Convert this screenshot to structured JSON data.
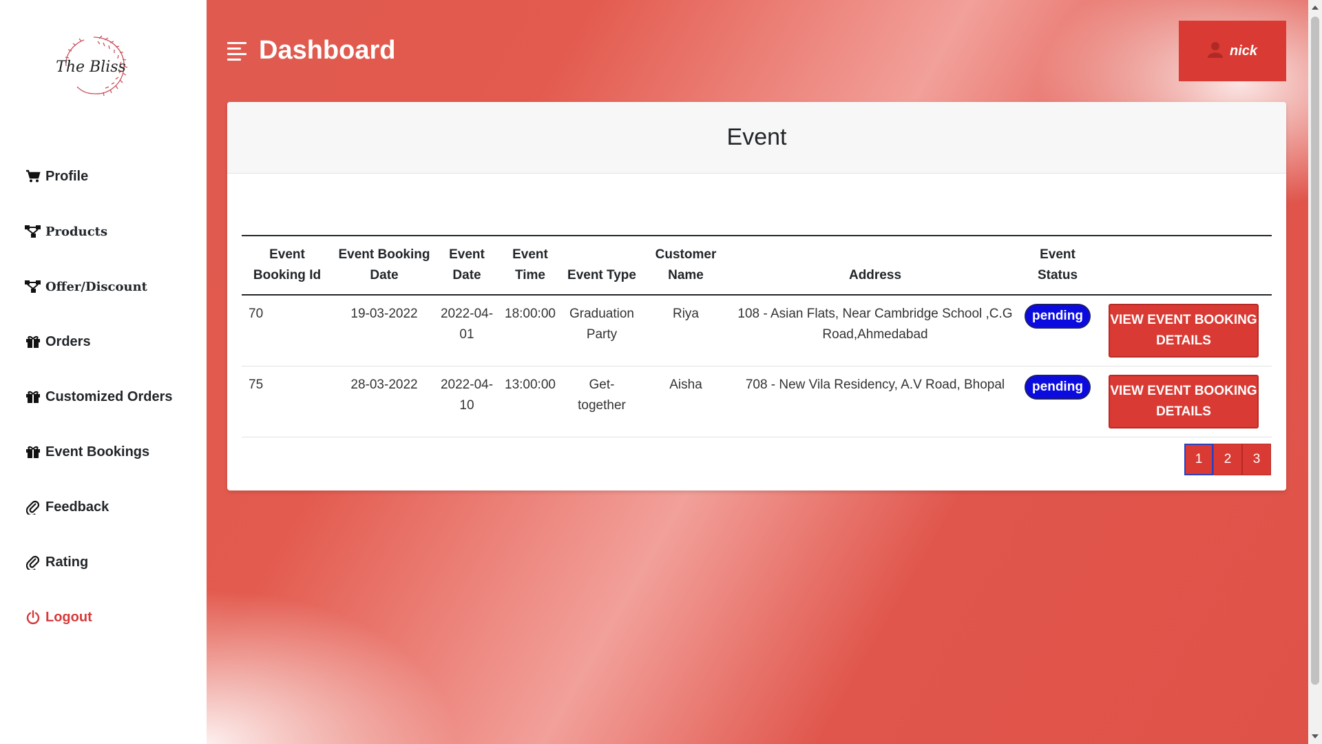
{
  "brand": {
    "logo_text": "The Bliss"
  },
  "sidebar": {
    "items": [
      {
        "label": "Profile",
        "icon": "cart-icon"
      },
      {
        "label": "Products",
        "icon": "sitemap-icon"
      },
      {
        "label": "Offer/Discount",
        "icon": "sitemap-icon"
      },
      {
        "label": "Orders",
        "icon": "gift-icon"
      },
      {
        "label": "Customized Orders",
        "icon": "gift-icon"
      },
      {
        "label": "Event Bookings",
        "icon": "gift-icon"
      },
      {
        "label": "Feedback",
        "icon": "paperclip-icon"
      },
      {
        "label": "Rating",
        "icon": "paperclip-icon"
      },
      {
        "label": "Logout",
        "icon": "power-icon"
      }
    ]
  },
  "header": {
    "title": "Dashboard",
    "user_name": "nick"
  },
  "card": {
    "title": "Event",
    "table": {
      "headers": {
        "booking_id": "Event Booking Id",
        "booking_date": "Event Booking Date",
        "event_date": "Event Date",
        "event_time": "Event Time",
        "event_type": "Event Type",
        "customer_name": "Customer Name",
        "address": "Address",
        "status": "Event Status"
      },
      "rows": [
        {
          "booking_id": "70",
          "booking_date": "19-03-2022",
          "event_date": "2022-04-01",
          "event_time": "18:00:00",
          "event_type": "Graduation Party",
          "customer_name": "Riya",
          "address": "108 - Asian Flats, Near Cambridge School ,C.G Road,Ahmedabad",
          "status": "pending",
          "action": "VIEW EVENT BOOKING DETAILS"
        },
        {
          "booking_id": "75",
          "booking_date": "28-03-2022",
          "event_date": "2022-04-10",
          "event_time": "13:00:00",
          "event_type": "Get-together",
          "customer_name": "Aisha",
          "address": "708 - New Vila Residency, A.V Road, Bhopal",
          "status": "pending",
          "action": "VIEW EVENT BOOKING DETAILS"
        }
      ]
    },
    "pagination": {
      "pages": [
        "1",
        "2",
        "3"
      ],
      "current": "1"
    }
  },
  "colors": {
    "accent": "#d93a33",
    "badge": "#0b0be0",
    "logout": "#d63a3a"
  }
}
